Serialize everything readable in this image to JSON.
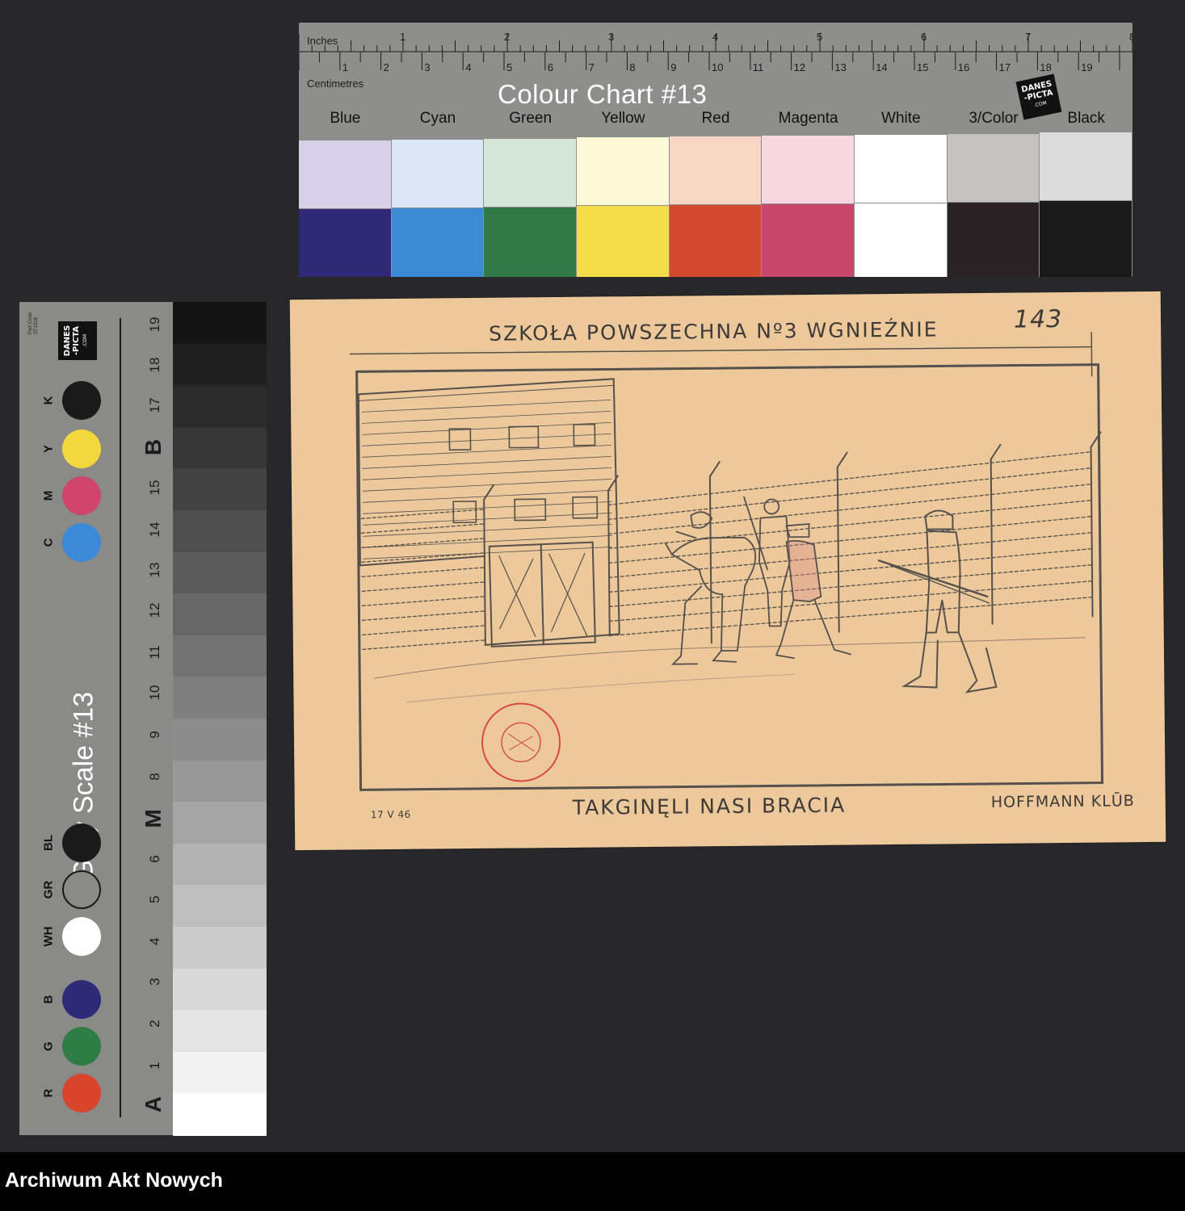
{
  "colour_chart": {
    "title": "Colour Chart #13",
    "ruler_inches_label": "Inches",
    "ruler_cm_label": "Centimetres",
    "inch_numbers": [
      "1",
      "2",
      "3",
      "4",
      "5",
      "6",
      "7",
      "8"
    ],
    "cm_numbers": [
      "1",
      "2",
      "3",
      "4",
      "5",
      "6",
      "7",
      "8",
      "9",
      "10",
      "11",
      "12",
      "13",
      "14",
      "15",
      "16",
      "17",
      "18",
      "19"
    ],
    "logo": {
      "line1": "DANES",
      "line2": "-PICTA",
      "line3": ".COM"
    },
    "swatches": [
      {
        "label": "Blue",
        "light": "#d6d0e8",
        "dark": "#2e2a78"
      },
      {
        "label": "Cyan",
        "light": "#dbe7f7",
        "dark": "#3b8ad6"
      },
      {
        "label": "Green",
        "light": "#d4e6d5",
        "dark": "#2f7a47"
      },
      {
        "label": "Yellow",
        "light": "#fdf8d6",
        "dark": "#f7dc4a"
      },
      {
        "label": "Red",
        "light": "#f8d6c5",
        "dark": "#d34a30"
      },
      {
        "label": "Magenta",
        "light": "#f6d6df",
        "dark": "#c8466a"
      },
      {
        "label": "White",
        "light": "#ffffff",
        "dark": "#ffffff"
      },
      {
        "label": "3/Color",
        "light": "#c6c2c2",
        "dark": "#2a2225"
      },
      {
        "label": "Black",
        "light": "#dcdcdd",
        "dark": "#1a1a1a"
      }
    ]
  },
  "grey_scale": {
    "title": "Grey Scale #13",
    "part_code": "Part Code ST1316",
    "logo": {
      "line1": "DANES",
      "line2": "-PICTA",
      "line3": ".COM"
    },
    "numbers": [
      "19",
      "18",
      "17",
      "15",
      "14",
      "13",
      "12",
      "11",
      "10",
      "9",
      "8",
      "6",
      "5",
      "4",
      "3",
      "2",
      "1"
    ],
    "letters": [
      "B",
      "M",
      "A"
    ],
    "dots": [
      {
        "label": "K",
        "color": "#1a1a1a"
      },
      {
        "label": "Y",
        "color": "#f2d83c"
      },
      {
        "label": "M",
        "color": "#d0466a"
      },
      {
        "label": "C",
        "color": "#3a8ad8"
      },
      {
        "label": "BL",
        "color": "#1a1a1a"
      },
      {
        "label": "GR",
        "color": "#8a8a88"
      },
      {
        "label": "WH",
        "color": "#ffffff"
      },
      {
        "label": "B",
        "color": "#2d2a78"
      },
      {
        "label": "G",
        "color": "#2e7d45"
      },
      {
        "label": "R",
        "color": "#d9452c"
      }
    ]
  },
  "drawing": {
    "header": "SZKOŁA POWSZECHNA Nº3 WGNIEŹNIE",
    "page_number": "143",
    "caption": "TAKGINĘLI NASI BRACIA",
    "date_note": "17 V 46",
    "signature": "HOFFMANN KLŪB",
    "stamp_color": "#d84a3c",
    "paper_color": "#ecc89a"
  },
  "footer": {
    "label": "Archiwum Akt Nowych"
  }
}
